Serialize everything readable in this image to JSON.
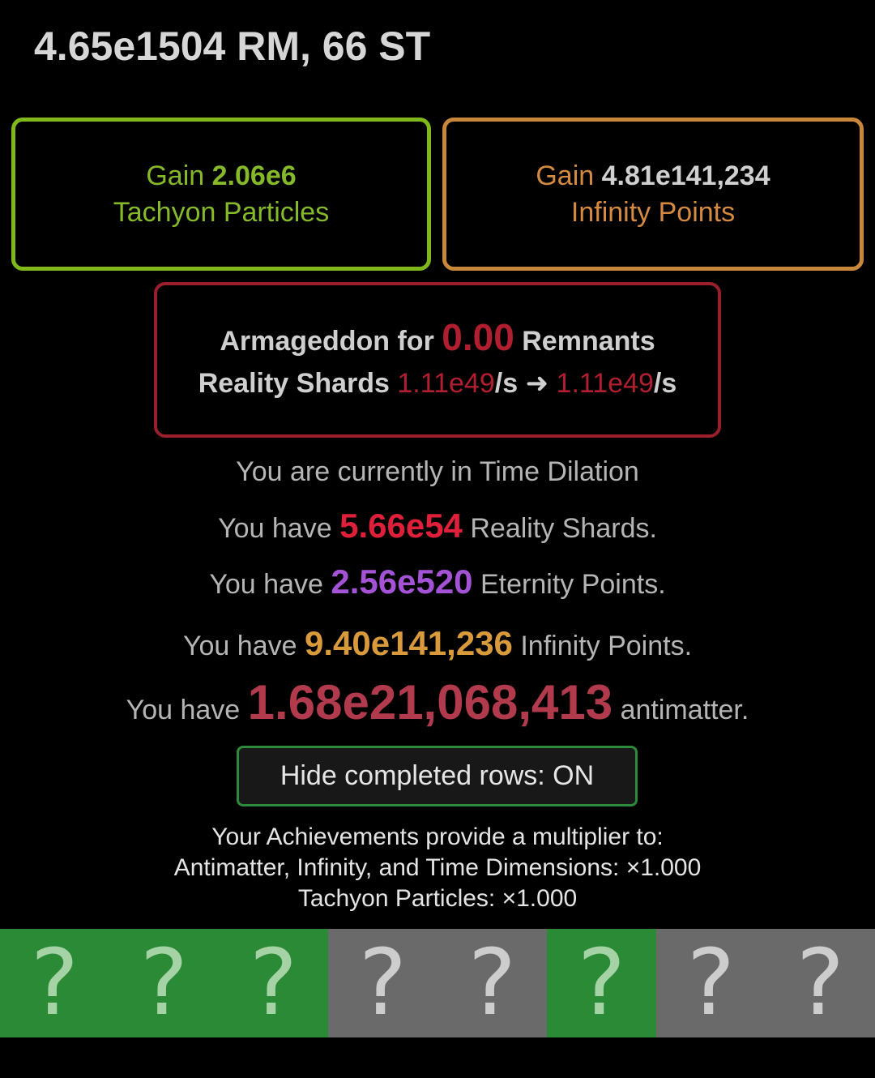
{
  "header": {
    "resources": "4.65e1504 RM, 66 ST"
  },
  "tachyon_box": {
    "prefix": "Gain",
    "value": "2.06e6",
    "label": "Tachyon Particles",
    "border_color": "#7fb81a"
  },
  "infinity_box": {
    "prefix": "Gain",
    "value": "4.81e141,234",
    "label": "Infinity Points",
    "border_color": "#c8873a"
  },
  "armageddon_box": {
    "prefix": "Armageddon for",
    "value": "0.00",
    "suffix": "Remnants",
    "shards_label": "Reality Shards",
    "rate_from": "1.11e49",
    "per_s_1": "/s",
    "arrow": "➜",
    "rate_to": "1.11e49",
    "per_s_2": "/s",
    "border_color": "#9a1e2c"
  },
  "status": {
    "dilation": "You are currently in Time Dilation"
  },
  "resources": [
    {
      "prefix": "You have",
      "value": "5.66e54",
      "suffix": "Reality Shards.",
      "color": "#e0203a"
    },
    {
      "prefix": "You have",
      "value": "2.56e520",
      "suffix": "Eternity Points.",
      "color": "#a452d6"
    },
    {
      "prefix": "You have",
      "value": "9.40e141,236",
      "suffix": "Infinity Points.",
      "color": "#d99a3c"
    },
    {
      "prefix": "You have",
      "value": "1.68e21,068,413",
      "suffix": "antimatter.",
      "color": "#b23a4d"
    }
  ],
  "toggle": {
    "label": "Hide completed rows: ON"
  },
  "achievements": {
    "line1": "Your Achievements provide a multiplier to:",
    "line2": "Antimatter, Infinity, and Time Dimensions: ×1.000",
    "line3": "Tachyon Particles: ×1.000",
    "cells": [
      {
        "glyph": "?",
        "state": "done"
      },
      {
        "glyph": "?",
        "state": "done"
      },
      {
        "glyph": "?",
        "state": "done"
      },
      {
        "glyph": "?",
        "state": "locked"
      },
      {
        "glyph": "?",
        "state": "locked"
      },
      {
        "glyph": "?",
        "state": "done"
      },
      {
        "glyph": "?",
        "state": "locked"
      },
      {
        "glyph": "?",
        "state": "locked"
      }
    ],
    "done_color": "#2b8a35",
    "locked_color": "#6a6a6a"
  }
}
